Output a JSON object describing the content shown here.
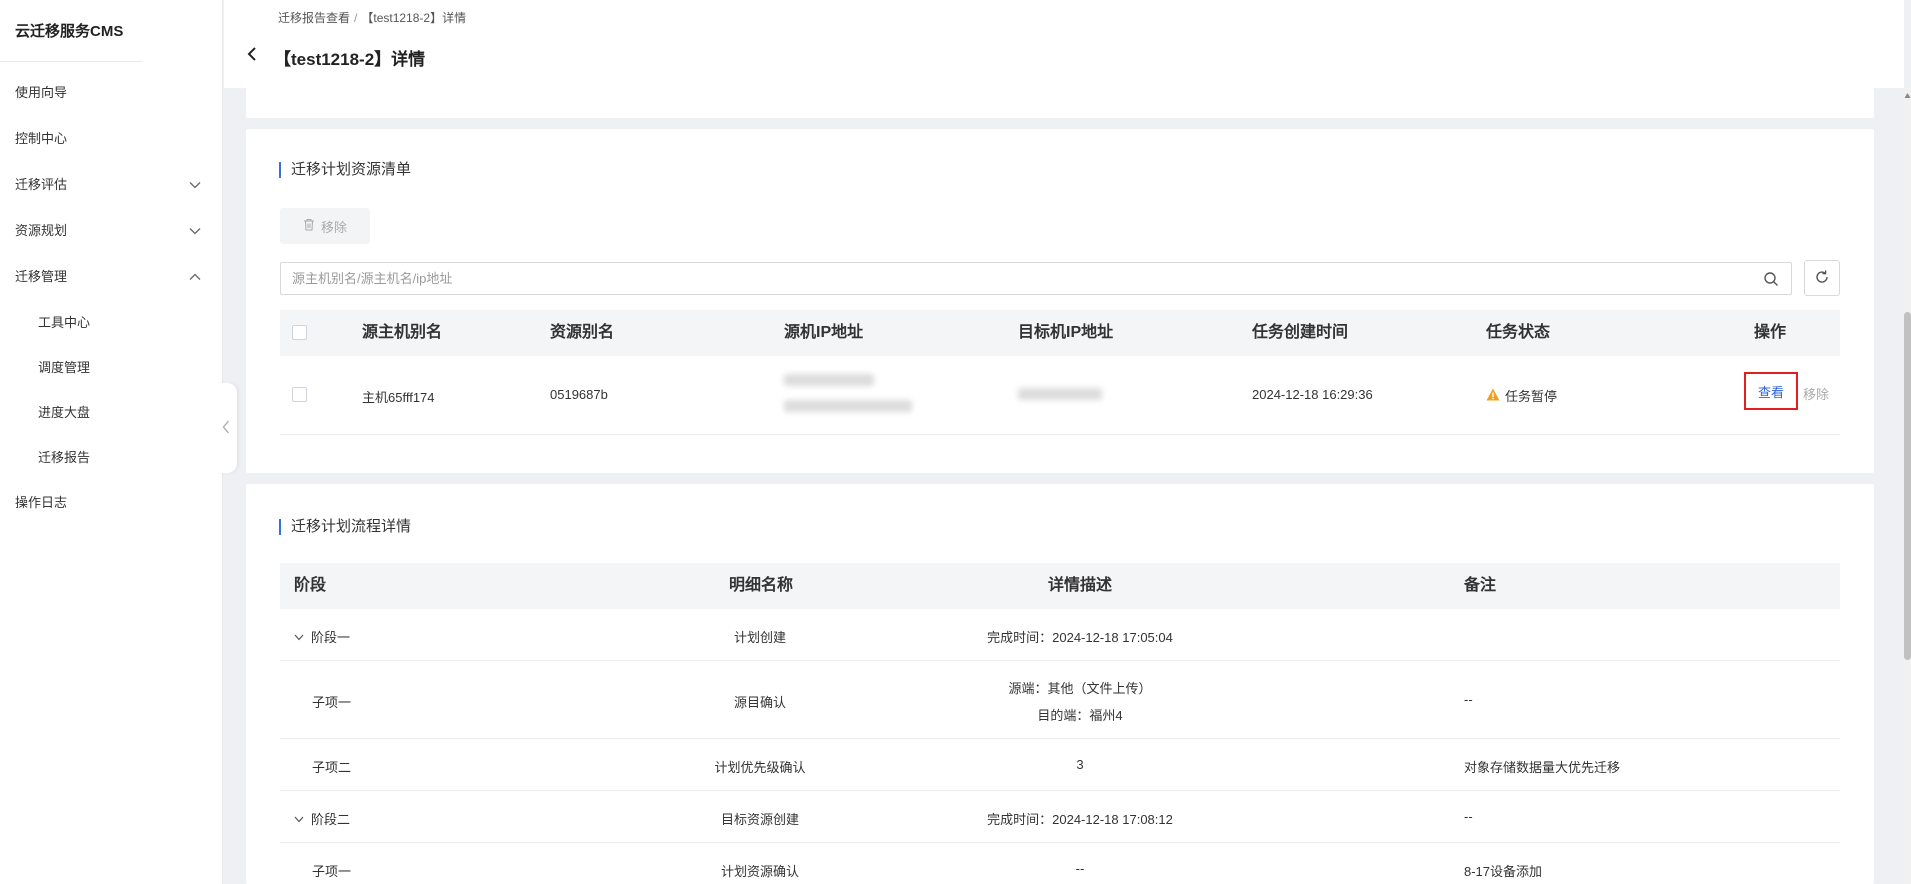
{
  "app": {
    "title": "云迁移服务CMS"
  },
  "sidebar": {
    "items": [
      {
        "label": "使用向导"
      },
      {
        "label": "控制中心"
      },
      {
        "label": "迁移评估",
        "chevron": "down"
      },
      {
        "label": "资源规划",
        "chevron": "down"
      },
      {
        "label": "迁移管理",
        "chevron": "up"
      },
      {
        "label": "工具中心"
      },
      {
        "label": "调度管理"
      },
      {
        "label": "进度大盘"
      },
      {
        "label": "迁移报告"
      },
      {
        "label": "操作日志"
      }
    ]
  },
  "header": {
    "breadcrumb": [
      "迁移报告查看",
      "【test1218-2】详情"
    ],
    "title": "【test1218-2】详情"
  },
  "resources": {
    "section_title": "迁移计划资源清单",
    "remove_label": "移除",
    "search_placeholder": "源主机别名/源主机名/ip地址",
    "columns": [
      "源主机别名",
      "资源别名",
      "源机IP地址",
      "目标机IP地址",
      "任务创建时间",
      "任务状态",
      "操作"
    ],
    "rows": [
      {
        "host_alias": "主机65fff174",
        "resource_alias": "0519687b",
        "created_at": "2024-12-18 16:29:36",
        "status": "任务暂停",
        "actions": [
          "查看",
          "移除"
        ]
      }
    ]
  },
  "flow": {
    "section_title": "迁移计划流程详情",
    "columns": [
      "阶段",
      "明细名称",
      "详情描述",
      "备注"
    ],
    "rows": [
      {
        "stage": "阶段一",
        "expandable": true,
        "name": "计划创建",
        "desc": [
          "完成时间：2024-12-18 17:05:04"
        ],
        "note": ""
      },
      {
        "stage": "子项一",
        "expandable": false,
        "name": "源目确认",
        "desc": [
          "源端：其他（文件上传）",
          "目的端：福州4"
        ],
        "note": "--"
      },
      {
        "stage": "子项二",
        "expandable": false,
        "name": "计划优先级确认",
        "desc": [
          "3"
        ],
        "note": "对象存储数据量大优先迁移"
      },
      {
        "stage": "阶段二",
        "expandable": true,
        "name": "目标资源创建",
        "desc": [
          "完成时间：2024-12-18 17:08:12"
        ],
        "note": "--"
      },
      {
        "stage": "子项一",
        "expandable": false,
        "name": "计划资源确认",
        "desc": [
          "--"
        ],
        "note": "8-17设备添加"
      }
    ]
  },
  "colors": {
    "accent": "#2f63d8",
    "highlight_border": "#e02020",
    "warning": "#f0a020"
  }
}
